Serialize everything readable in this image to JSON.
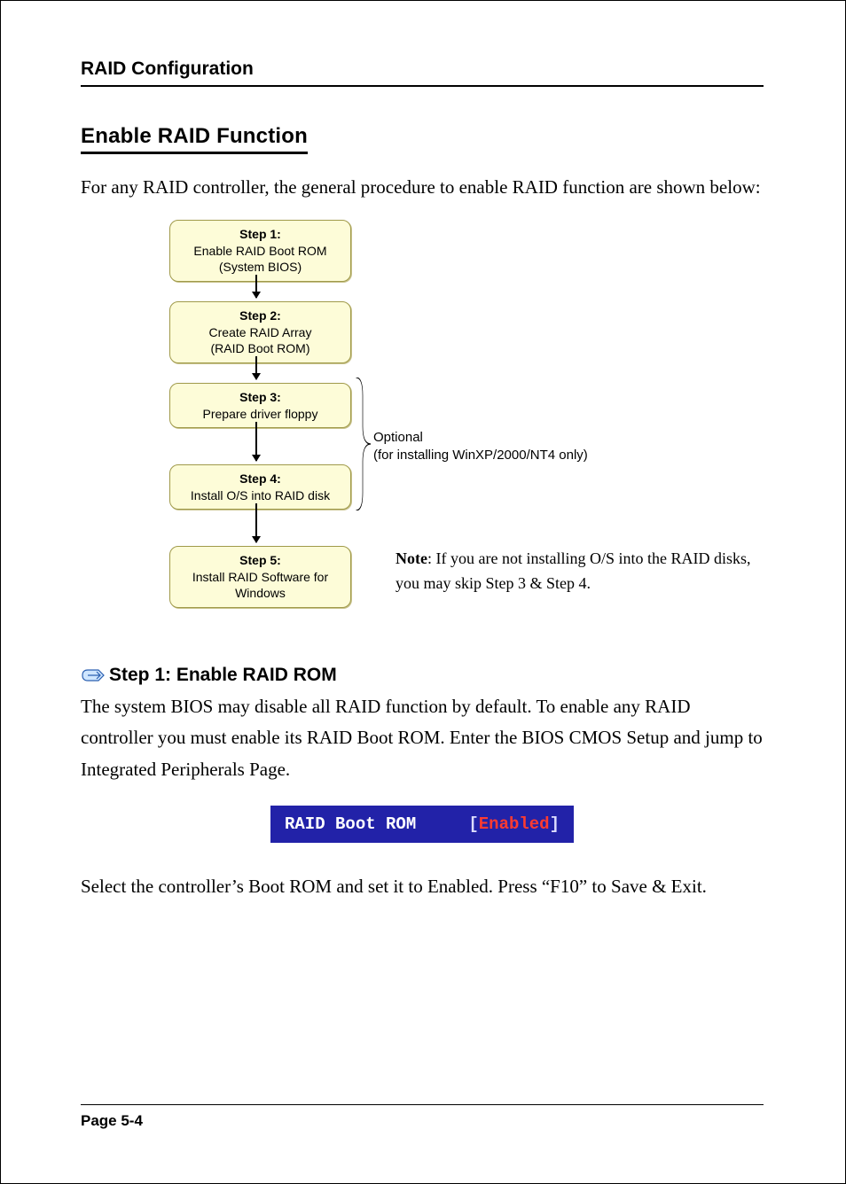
{
  "header": {
    "title": "RAID Configuration"
  },
  "section": {
    "title": "Enable RAID Function"
  },
  "intro": "For any RAID controller, the general procedure to enable RAID function are shown below:",
  "chart_data": {
    "type": "flowchart-linear",
    "steps": [
      {
        "label": "Step 1:",
        "text1": "Enable RAID Boot ROM",
        "text2": "(System BIOS)"
      },
      {
        "label": "Step 2:",
        "text1": "Create RAID Array",
        "text2": "(RAID Boot ROM)"
      },
      {
        "label": "Step 3:",
        "text1": "Prepare driver floppy",
        "text2": ""
      },
      {
        "label": "Step 4:",
        "text1": "Install O/S into RAID disk",
        "text2": ""
      },
      {
        "label": "Step 5:",
        "text1": "Install RAID Software for Windows",
        "text2": ""
      }
    ],
    "optional_group": {
      "covers_steps": [
        3,
        4
      ],
      "head": "Optional",
      "detail": "(for installing WinXP/2000/NT4 only)"
    },
    "note": {
      "bold": "Note",
      "text": ": If you are not installing O/S into the RAID disks, you may skip Step 3 & Step 4."
    }
  },
  "step1": {
    "heading": "Step 1: Enable RAID ROM",
    "para1": "The system BIOS may disable all RAID function by default.  To enable any RAID controller you must enable its RAID Boot ROM.  Enter the BIOS CMOS Setup and jump to Integrated Peripherals Page.",
    "bios_label": "RAID Boot ROM",
    "bios_value": "Enabled",
    "para2": "Select the controller’s Boot ROM and set it to Enabled.  Press “F10” to Save & Exit."
  },
  "footer": {
    "page": "Page 5-4"
  }
}
